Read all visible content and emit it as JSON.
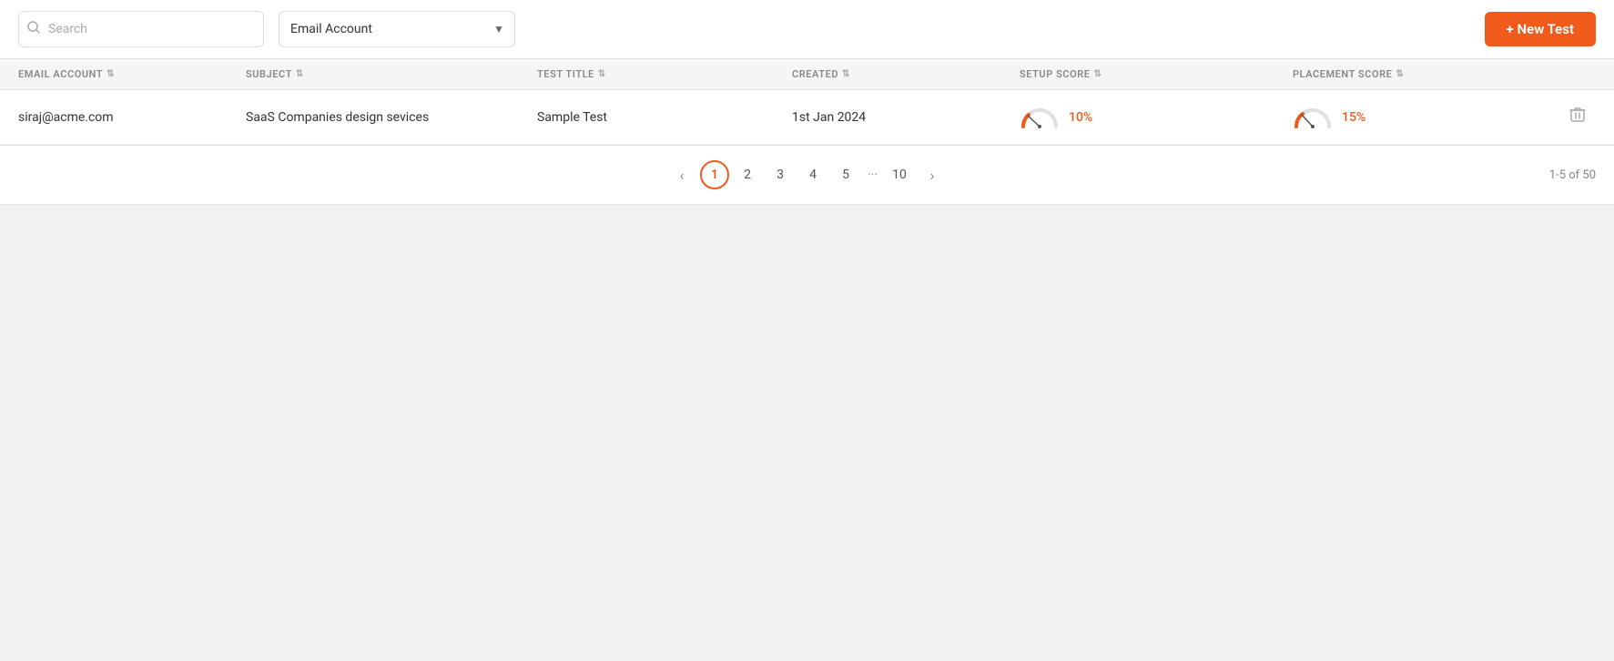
{
  "toolbar": {
    "search_placeholder": "Search",
    "email_select_label": "Email Account",
    "new_test_button_label": "+ New Test"
  },
  "table": {
    "headers": [
      {
        "id": "email-account",
        "label": "EMAIL ACCOUNT",
        "sortable": true
      },
      {
        "id": "subject",
        "label": "SUBJECT",
        "sortable": true
      },
      {
        "id": "test-title",
        "label": "TEST TITLE",
        "sortable": true
      },
      {
        "id": "created",
        "label": "CREATED",
        "sortable": true
      },
      {
        "id": "setup-score",
        "label": "SETUP SCORE",
        "sortable": true
      },
      {
        "id": "placement-score",
        "label": "PLACEMENT SCORE",
        "sortable": true
      },
      {
        "id": "actions",
        "label": "",
        "sortable": false
      }
    ],
    "rows": [
      {
        "email_account": "siraj@acme.com",
        "subject": "SaaS Companies design sevices",
        "test_title": "Sample Test",
        "created": "1st Jan 2024",
        "setup_score": "10%",
        "placement_score": "15%"
      }
    ]
  },
  "pagination": {
    "pages": [
      "1",
      "2",
      "3",
      "4",
      "5",
      "10"
    ],
    "current_page": "1",
    "dots": "···",
    "info": "1-5 of 50"
  }
}
